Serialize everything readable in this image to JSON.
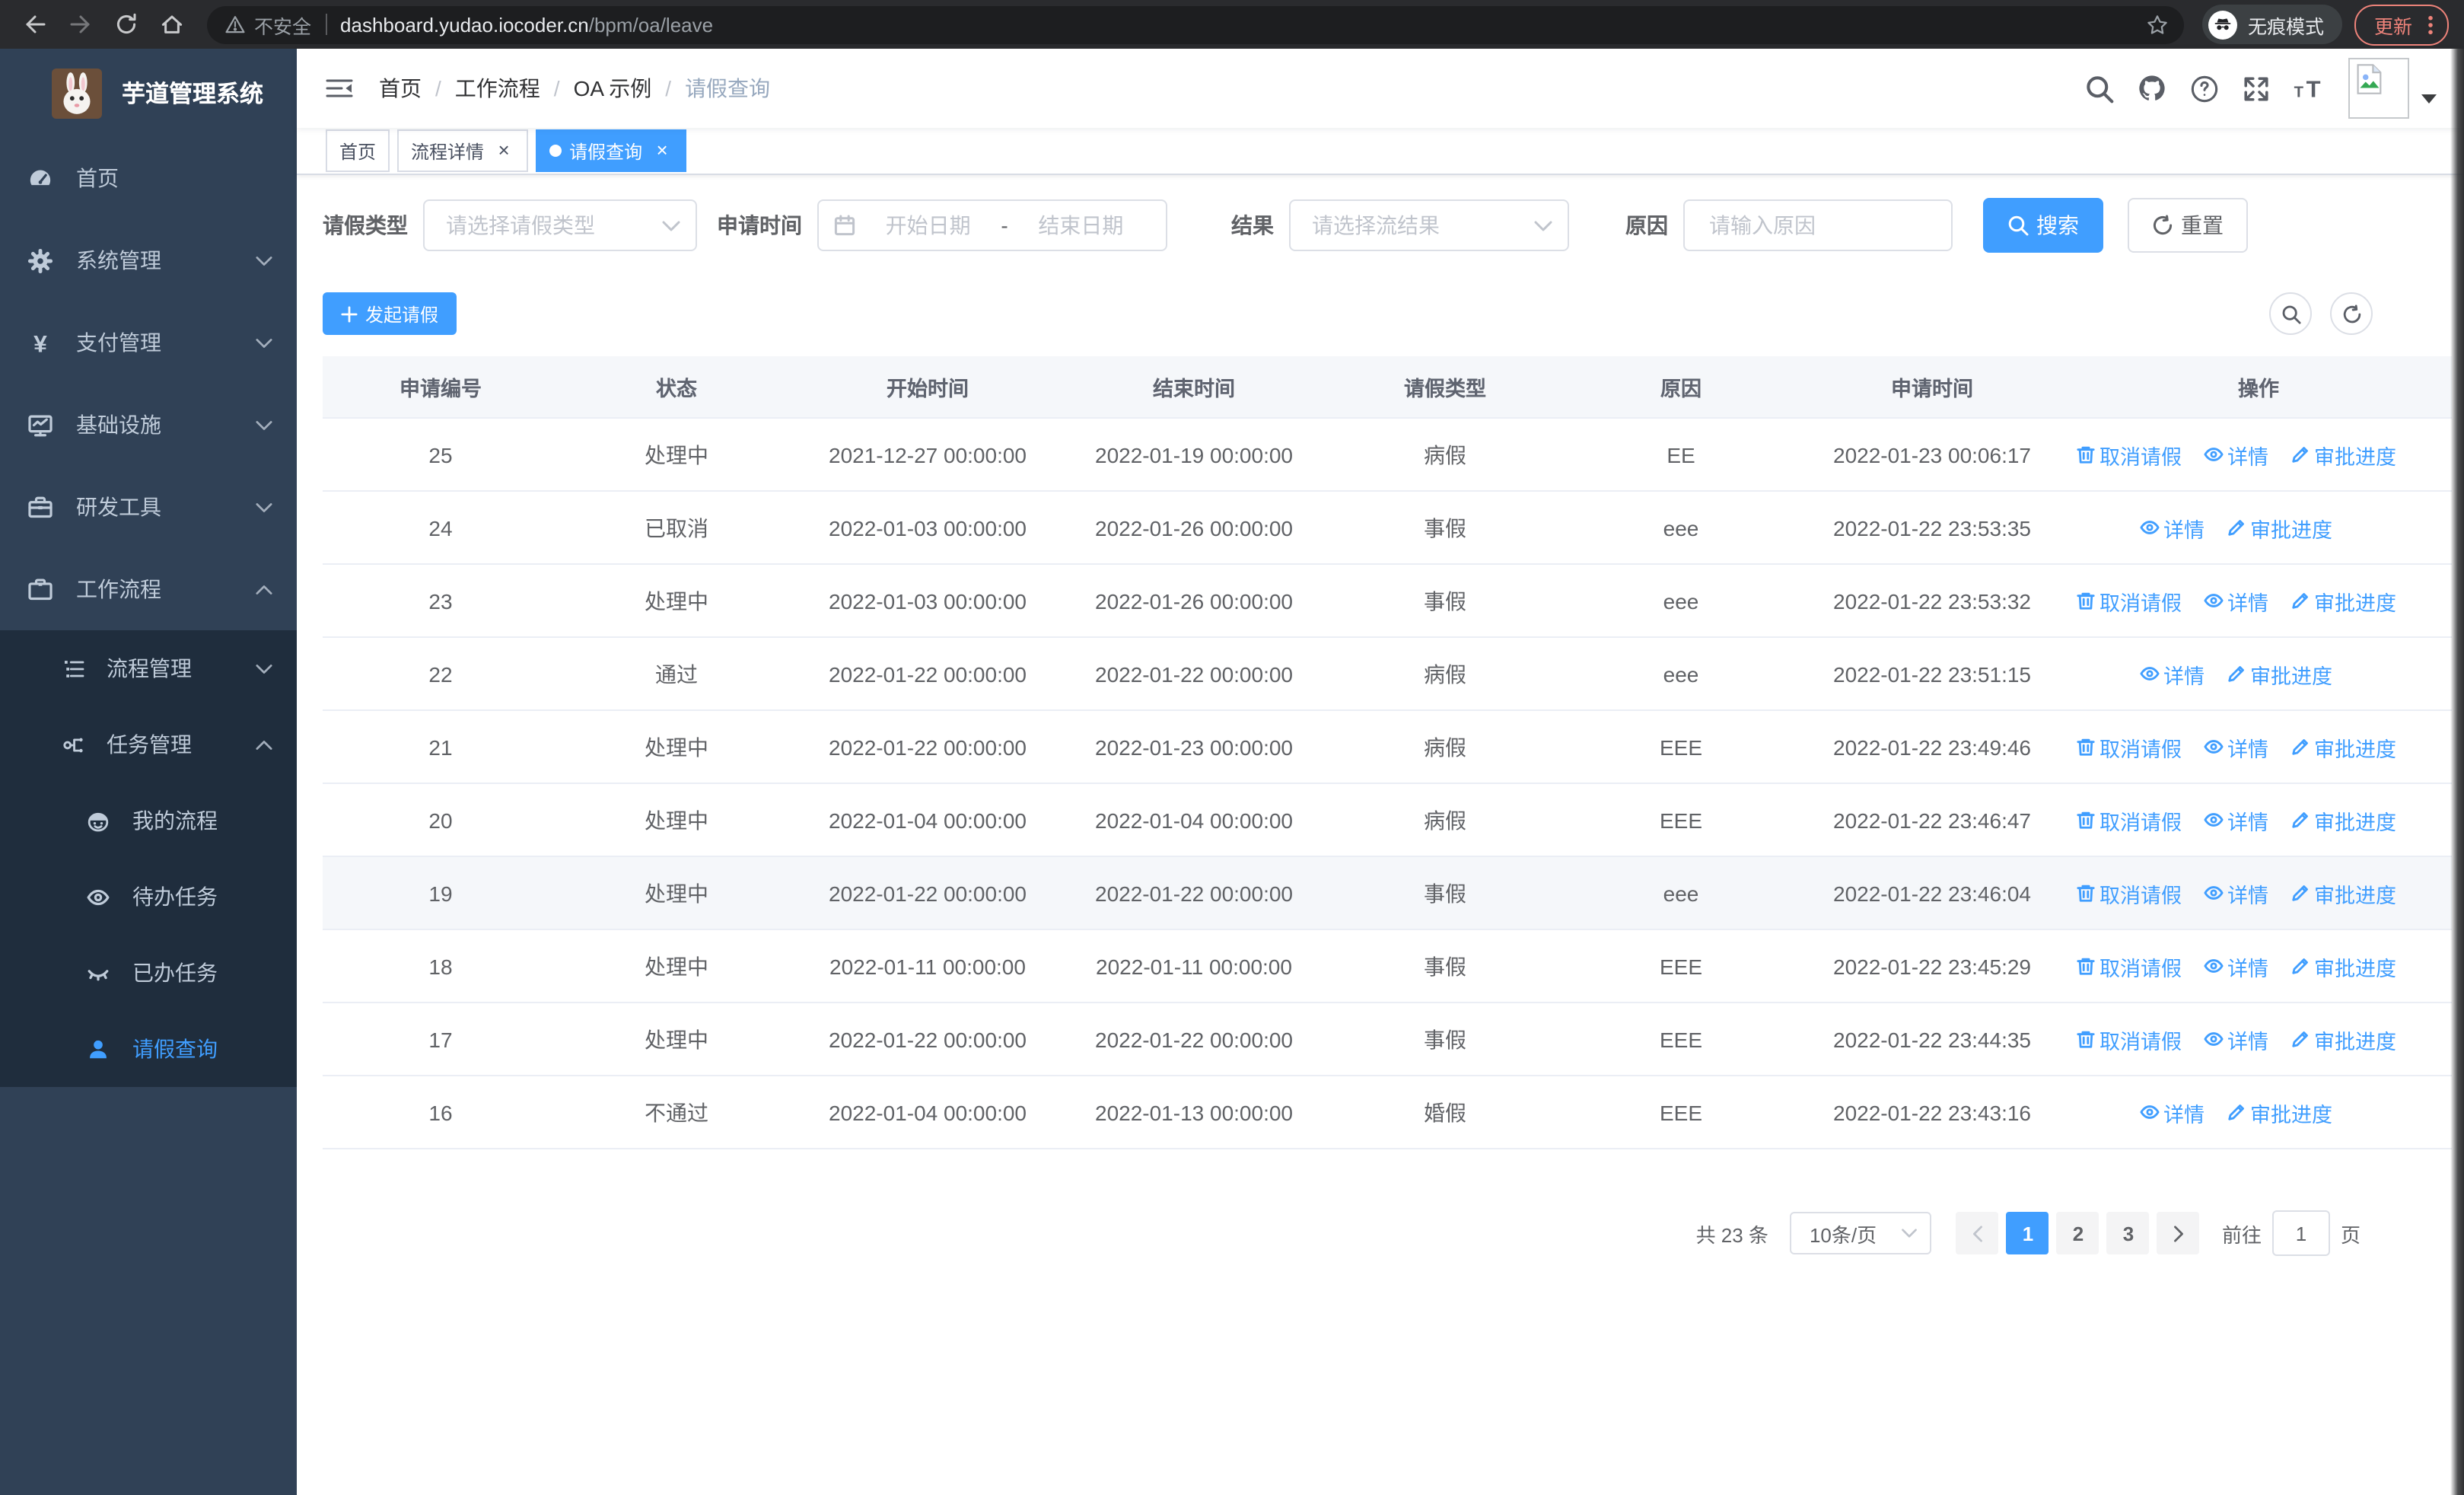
{
  "browser": {
    "security_label": "不安全",
    "url_host": "dashboard.yudao.iocoder.cn",
    "url_path": "/bpm/oa/leave",
    "incognito_label": "无痕模式",
    "update_label": "更新"
  },
  "sidebar": {
    "title": "芋道管理系统",
    "items": [
      {
        "name": "home",
        "label": "首页",
        "icon": "dashboard-icon",
        "expandable": false
      },
      {
        "name": "system",
        "label": "系统管理",
        "icon": "gear-icon",
        "expandable": true,
        "expanded": false
      },
      {
        "name": "payment",
        "label": "支付管理",
        "icon": "yen-icon",
        "expandable": true,
        "expanded": false
      },
      {
        "name": "infrastructure",
        "label": "基础设施",
        "icon": "monitor-icon",
        "expandable": true,
        "expanded": false
      },
      {
        "name": "devtools",
        "label": "研发工具",
        "icon": "toolbox-icon",
        "expandable": true,
        "expanded": false
      },
      {
        "name": "workflow",
        "label": "工作流程",
        "icon": "briefcase-icon",
        "expandable": true,
        "expanded": true
      }
    ],
    "submenu": [
      {
        "name": "process-management",
        "label": "流程管理",
        "icon": "list-icon",
        "expandable": true,
        "expanded": false,
        "level": 1
      },
      {
        "name": "task-management",
        "label": "任务管理",
        "icon": "flow-icon",
        "expandable": true,
        "expanded": true,
        "level": 1
      },
      {
        "name": "my-process",
        "label": "我的流程",
        "icon": "robot-icon",
        "level": 2
      },
      {
        "name": "todo-tasks",
        "label": "待办任务",
        "icon": "eye-open-icon",
        "level": 2
      },
      {
        "name": "done-tasks",
        "label": "已办任务",
        "icon": "eye-closed-icon",
        "level": 2
      },
      {
        "name": "leave-query",
        "label": "请假查询",
        "icon": "user-icon",
        "level": 2,
        "active": true
      }
    ]
  },
  "navbar": {
    "breadcrumb": [
      "首页",
      "工作流程",
      "OA 示例",
      "请假查询"
    ]
  },
  "tabs": [
    {
      "name": "home",
      "label": "首页",
      "closable": false,
      "active": false
    },
    {
      "name": "process-detail",
      "label": "流程详情",
      "closable": true,
      "active": false
    },
    {
      "name": "leave-query",
      "label": "请假查询",
      "closable": true,
      "active": true
    }
  ],
  "filters": {
    "leave_type": {
      "label": "请假类型",
      "placeholder": "请选择请假类型"
    },
    "apply_time": {
      "label": "申请时间",
      "start_placeholder": "开始日期",
      "separator": "-",
      "end_placeholder": "结束日期"
    },
    "result": {
      "label": "结果",
      "placeholder": "请选择流结果"
    },
    "reason": {
      "label": "原因",
      "placeholder": "请输入原因"
    },
    "search_label": "搜索",
    "reset_label": "重置"
  },
  "toolbar": {
    "create_label": "发起请假"
  },
  "table": {
    "columns": [
      "申请编号",
      "状态",
      "开始时间",
      "结束时间",
      "请假类型",
      "原因",
      "申请时间",
      "操作"
    ],
    "action_labels": {
      "cancel": "取消请假",
      "detail": "详情",
      "progress": "审批进度"
    },
    "rows": [
      {
        "id": "25",
        "status": "处理中",
        "start": "2021-12-27 00:00:00",
        "end": "2022-01-19 00:00:00",
        "type": "病假",
        "reason": "EE",
        "applied": "2022-01-23 00:06:17",
        "actions": [
          "cancel",
          "detail",
          "progress"
        ],
        "highlight": false
      },
      {
        "id": "24",
        "status": "已取消",
        "start": "2022-01-03 00:00:00",
        "end": "2022-01-26 00:00:00",
        "type": "事假",
        "reason": "eee",
        "applied": "2022-01-22 23:53:35",
        "actions": [
          "detail",
          "progress"
        ],
        "highlight": false
      },
      {
        "id": "23",
        "status": "处理中",
        "start": "2022-01-03 00:00:00",
        "end": "2022-01-26 00:00:00",
        "type": "事假",
        "reason": "eee",
        "applied": "2022-01-22 23:53:32",
        "actions": [
          "cancel",
          "detail",
          "progress"
        ],
        "highlight": false
      },
      {
        "id": "22",
        "status": "通过",
        "start": "2022-01-22 00:00:00",
        "end": "2022-01-22 00:00:00",
        "type": "病假",
        "reason": "eee",
        "applied": "2022-01-22 23:51:15",
        "actions": [
          "detail",
          "progress"
        ],
        "highlight": false
      },
      {
        "id": "21",
        "status": "处理中",
        "start": "2022-01-22 00:00:00",
        "end": "2022-01-23 00:00:00",
        "type": "病假",
        "reason": "EEE",
        "applied": "2022-01-22 23:49:46",
        "actions": [
          "cancel",
          "detail",
          "progress"
        ],
        "highlight": false
      },
      {
        "id": "20",
        "status": "处理中",
        "start": "2022-01-04 00:00:00",
        "end": "2022-01-04 00:00:00",
        "type": "病假",
        "reason": "EEE",
        "applied": "2022-01-22 23:46:47",
        "actions": [
          "cancel",
          "detail",
          "progress"
        ],
        "highlight": false
      },
      {
        "id": "19",
        "status": "处理中",
        "start": "2022-01-22 00:00:00",
        "end": "2022-01-22 00:00:00",
        "type": "事假",
        "reason": "eee",
        "applied": "2022-01-22 23:46:04",
        "actions": [
          "cancel",
          "detail",
          "progress"
        ],
        "highlight": true
      },
      {
        "id": "18",
        "status": "处理中",
        "start": "2022-01-11 00:00:00",
        "end": "2022-01-11 00:00:00",
        "type": "事假",
        "reason": "EEE",
        "applied": "2022-01-22 23:45:29",
        "actions": [
          "cancel",
          "detail",
          "progress"
        ],
        "highlight": false
      },
      {
        "id": "17",
        "status": "处理中",
        "start": "2022-01-22 00:00:00",
        "end": "2022-01-22 00:00:00",
        "type": "事假",
        "reason": "EEE",
        "applied": "2022-01-22 23:44:35",
        "actions": [
          "cancel",
          "detail",
          "progress"
        ],
        "highlight": false
      },
      {
        "id": "16",
        "status": "不通过",
        "start": "2022-01-04 00:00:00",
        "end": "2022-01-13 00:00:00",
        "type": "婚假",
        "reason": "EEE",
        "applied": "2022-01-22 23:43:16",
        "actions": [
          "detail",
          "progress"
        ],
        "highlight": false
      }
    ]
  },
  "pagination": {
    "total_label": "共 23 条",
    "page_size": "10条/页",
    "pages": [
      "1",
      "2",
      "3"
    ],
    "active_page": "1",
    "goto_label": "前往",
    "goto_value": "1",
    "unit_label": "页"
  },
  "colors": {
    "accent": "#409eff",
    "sidebar_bg": "#304156",
    "submenu_bg": "#1f2d3d",
    "sidebar_text": "#bfcbd9",
    "table_header_bg": "#f5f7fa",
    "update_button": "#ee837a"
  }
}
